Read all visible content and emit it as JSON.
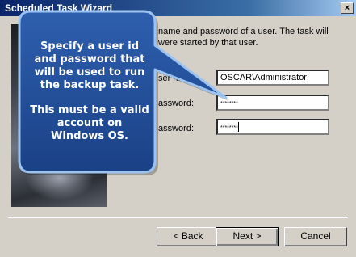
{
  "window": {
    "title": "Scheduled Task Wizard",
    "close_glyph": "×"
  },
  "description": "name and password of a user. The task will\nwere started by that user.",
  "fields": {
    "username_label": "ser na",
    "username_value": "OSCAR\\Administrator",
    "password_label": "assword:",
    "password_value": "********",
    "confirm_label": "assword:",
    "confirm_value": "********"
  },
  "buttons": {
    "back": "< Back",
    "next": "Next >",
    "cancel": "Cancel"
  },
  "callout": {
    "line1": "Specify a user id and password that will be used to run the backup task.",
    "line2": "This must be a valid account on Windows OS.",
    "color": "#1f4e99"
  },
  "icons": {
    "close": "close-icon"
  }
}
